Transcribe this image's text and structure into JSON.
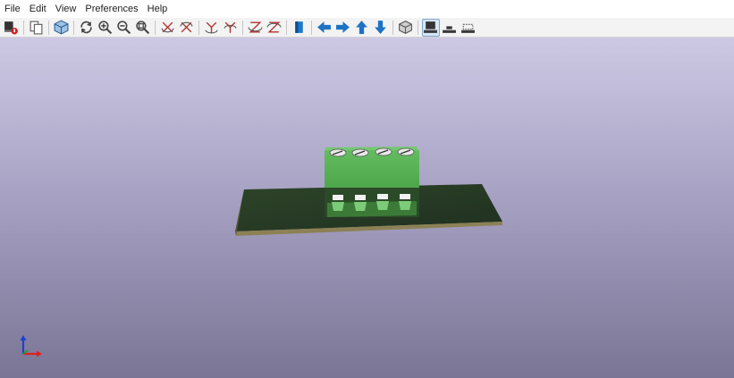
{
  "menubar": {
    "items": [
      {
        "label": "File"
      },
      {
        "label": "Edit"
      },
      {
        "label": "View"
      },
      {
        "label": "Preferences"
      },
      {
        "label": "Help"
      }
    ]
  },
  "toolbar": {
    "buttons": [
      {
        "icon": "render-raytracing-icon",
        "checked": false
      },
      {
        "icon": "copy-to-clipboard-icon",
        "checked": false
      },
      {
        "icon": "3d-box-toggle-icon",
        "checked": false
      },
      {
        "icon": "reload-icon",
        "checked": false
      },
      {
        "icon": "zoom-in-icon",
        "checked": false
      },
      {
        "icon": "zoom-out-icon",
        "checked": false
      },
      {
        "icon": "zoom-fit-icon",
        "checked": false
      },
      {
        "icon": "rotate-x-cw-icon",
        "checked": false
      },
      {
        "icon": "rotate-x-ccw-icon",
        "checked": false
      },
      {
        "icon": "rotate-y-cw-icon",
        "checked": false
      },
      {
        "icon": "rotate-y-ccw-icon",
        "checked": false
      },
      {
        "icon": "rotate-z-cw-icon",
        "checked": false
      },
      {
        "icon": "rotate-z-ccw-icon",
        "checked": false
      },
      {
        "icon": "flip-board-icon",
        "checked": false
      },
      {
        "icon": "move-left-icon",
        "checked": false
      },
      {
        "icon": "move-right-icon",
        "checked": false
      },
      {
        "icon": "move-up-icon",
        "checked": false
      },
      {
        "icon": "move-down-icon",
        "checked": false
      },
      {
        "icon": "ortho-toggle-icon",
        "checked": false
      },
      {
        "icon": "show-tht-models-icon",
        "checked": true
      },
      {
        "icon": "show-smd-models-icon",
        "checked": false
      },
      {
        "icon": "show-virtual-models-icon",
        "checked": false
      }
    ]
  },
  "scene": {
    "background_top": "#cdc9e4",
    "background_bottom": "#7a7595",
    "pcb_color": "#2a3d26",
    "pcb_edge_color": "#8c8255",
    "connector_color": "#5fb55a",
    "connector_shadow": "#3a7a37",
    "pin_count": 4
  },
  "axes": {
    "x_color": "#e02020",
    "y_color": "#20a020",
    "z_color": "#2040d0"
  }
}
